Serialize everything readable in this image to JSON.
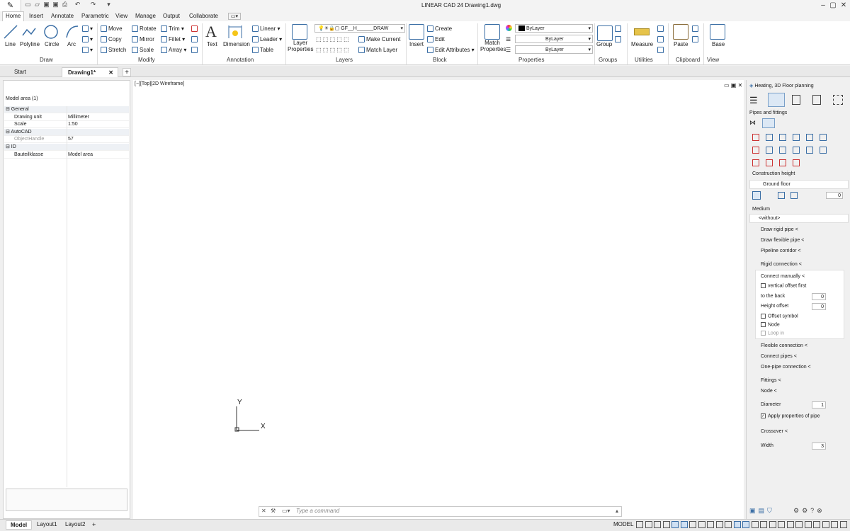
{
  "app": {
    "title": "LINEAR CAD 24   Drawing1.dwg"
  },
  "ribbon_tabs": [
    "Home",
    "Insert",
    "Annotate",
    "Parametric",
    "View",
    "Manage",
    "Output",
    "Collaborate"
  ],
  "draw": {
    "line": "Line",
    "polyline": "Polyline",
    "circle": "Circle",
    "arc": "Arc",
    "label": "Draw"
  },
  "modify": {
    "move": "Move",
    "rotate": "Rotate",
    "trim": "Trim",
    "copy": "Copy",
    "mirror": "Mirror",
    "fillet": "Fillet",
    "stretch": "Stretch",
    "scale": "Scale",
    "array": "Array",
    "label": "Modify"
  },
  "annotation": {
    "text": "Text",
    "dimension": "Dimension",
    "linear": "Linear",
    "leader": "Leader",
    "table": "Table",
    "label": "Annotation"
  },
  "layers": {
    "layer_properties": "Layer Properties",
    "layer_name": "GF__H______DRAW",
    "make_current": "Make Current",
    "match_layer": "Match Layer",
    "label": "Layers"
  },
  "block": {
    "insert": "Insert",
    "create": "Create",
    "edit": "Edit",
    "edit_attributes": "Edit Attributes",
    "label": "Block"
  },
  "properties": {
    "match": "Match Properties",
    "color": "ByLayer",
    "linetype": "ByLayer",
    "lineweight": "ByLayer",
    "label": "Properties"
  },
  "groups": {
    "group": "Group",
    "label": "Groups"
  },
  "utilities": {
    "measure": "Measure",
    "label": "Utilities"
  },
  "clipboard": {
    "paste": "Paste",
    "label": "Clipboard"
  },
  "view": {
    "base": "Base",
    "label": "View"
  },
  "doc_tabs": {
    "start": "Start",
    "drawing": "Drawing1*"
  },
  "left_panel": {
    "title": "Model area (1)",
    "rows": [
      {
        "cat": true,
        "name": "General",
        "value": ""
      },
      {
        "cat": false,
        "name": "Drawing unit",
        "value": "Millimeter"
      },
      {
        "cat": false,
        "name": "Scale",
        "value": "1:50"
      },
      {
        "cat": true,
        "name": "AutoCAD",
        "value": ""
      },
      {
        "cat": false,
        "name": "ObjectHandle",
        "value": "57"
      },
      {
        "cat": true,
        "name": "ID",
        "value": ""
      },
      {
        "cat": false,
        "name": "Bauteilklasse",
        "value": "Model area"
      }
    ]
  },
  "viewport": {
    "label": "[−][Top][2D Wireframe]",
    "axis_x": "X",
    "axis_y": "Y"
  },
  "right_panel": {
    "title": "Heating, 3D Floor planning",
    "section": "Pipes and fittings",
    "construction_height": "Construction height",
    "ground_floor": "Ground floor",
    "height_value": "0",
    "medium_label": "Medium",
    "medium_value": "<without>",
    "draw_rigid": "Draw rigid pipe <",
    "draw_flexible": "Draw flexible pipe <",
    "pipeline_corridor": "Pipeline corridor <",
    "rigid_connection": "Rigid connection <",
    "connect_manually": "Connect manually <",
    "vertical_offset": "vertical offset first",
    "to_back": "to the back",
    "to_back_value": "0",
    "height_offset": "Height offset",
    "height_offset_value": "0",
    "offset_symbol": "Offset symbol",
    "node_chk": "Node",
    "loop_in": "Loop in",
    "flexible_connection": "Flexible connection <",
    "connect_pipes": "Connect pipes <",
    "one_pipe": "One-pipe connection <",
    "fittings": "Fittings <",
    "node": "Node <",
    "diameter": "Diameter",
    "diameter_value": "1",
    "apply_props": "Apply properties of pipe",
    "crossover": "Crossover <",
    "width": "Width",
    "width_value": "3"
  },
  "command": {
    "placeholder": "Type a command"
  },
  "status": {
    "model": "Model",
    "layout1": "Layout1",
    "layout2": "Layout2",
    "model_btn": "MODEL"
  }
}
